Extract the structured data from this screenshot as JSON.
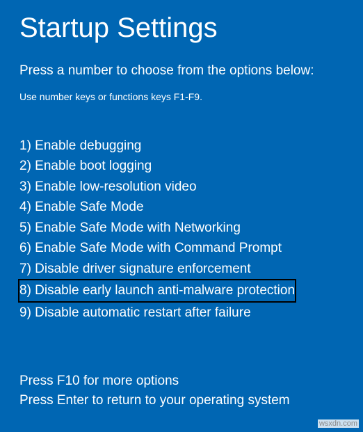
{
  "title": "Startup Settings",
  "instruction": "Press a number to choose from the options below:",
  "hint": "Use number keys or functions keys F1-F9.",
  "options": [
    {
      "num": "1",
      "label": "Enable debugging",
      "highlighted": false
    },
    {
      "num": "2",
      "label": "Enable boot logging",
      "highlighted": false
    },
    {
      "num": "3",
      "label": "Enable low-resolution video",
      "highlighted": false
    },
    {
      "num": "4",
      "label": "Enable Safe Mode",
      "highlighted": false
    },
    {
      "num": "5",
      "label": "Enable Safe Mode with Networking",
      "highlighted": false
    },
    {
      "num": "6",
      "label": "Enable Safe Mode with Command Prompt",
      "highlighted": false
    },
    {
      "num": "7",
      "label": "Disable driver signature enforcement",
      "highlighted": false
    },
    {
      "num": "8",
      "label": "Disable early launch anti-malware protection",
      "highlighted": true
    },
    {
      "num": "9",
      "label": "Disable automatic restart after failure",
      "highlighted": false
    }
  ],
  "footer": {
    "line1": "Press F10 for more options",
    "line2": "Press Enter to return to your operating system"
  },
  "watermark": "wsxdn.com"
}
